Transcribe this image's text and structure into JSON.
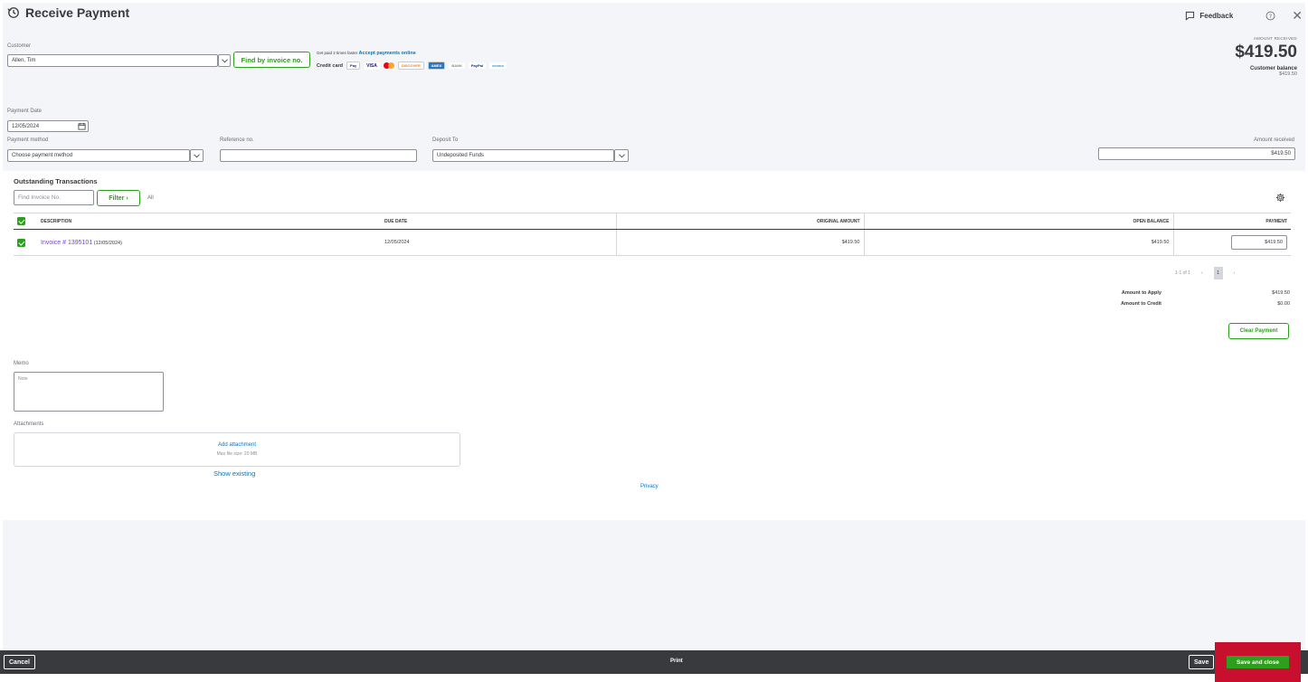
{
  "header": {
    "title": "Receive Payment",
    "feedback_label": "Feedback",
    "history_icon": "history-icon",
    "help_icon": "help-icon",
    "close_icon": "close-icon"
  },
  "customer": {
    "label": "Customer",
    "value": "Allen, Tim",
    "find_by_invoice_label": "Find by invoice no."
  },
  "promo": {
    "text": "Get paid 2 times faster",
    "link": "Accept payments online",
    "credit_card_label": "Credit card",
    "cards": [
      "Pay",
      "VISA",
      "DISCOVER",
      "AMEX",
      "BANK",
      "PayPal",
      "venmo"
    ]
  },
  "amount_summary": {
    "label": "AMOUNT RECEIVED",
    "value": "$419.50",
    "customer_balance_label": "Customer balance",
    "customer_balance_value": "$419.50"
  },
  "payment_date": {
    "label": "Payment Date",
    "value": "12/05/2024"
  },
  "payment_method": {
    "label": "Payment method",
    "placeholder": "Choose payment method"
  },
  "reference": {
    "label": "Reference no.",
    "value": ""
  },
  "deposit_to": {
    "label": "Deposit To",
    "value": "Undeposited Funds"
  },
  "amount_received": {
    "label": "Amount received",
    "value": "$419.50"
  },
  "outstanding": {
    "title": "Outstanding Transactions",
    "search_placeholder": "Find Invoice No.",
    "filter_label": "Filter",
    "all_label": "All",
    "columns": [
      "DESCRIPTION",
      "DUE DATE",
      "ORIGINAL AMOUNT",
      "OPEN BALANCE",
      "PAYMENT"
    ],
    "rows": [
      {
        "invoice": "Invoice # 1395101",
        "invoice_date": "(12/05/2024)",
        "due_date": "12/05/2024",
        "original_amount": "$419.50",
        "open_balance": "$419.50",
        "payment": "$419.50"
      }
    ],
    "pager_text": "1-1 of 1",
    "current_page": "1"
  },
  "totals": {
    "apply_label": "Amount to Apply",
    "apply_value": "$419.50",
    "credit_label": "Amount to Credit",
    "credit_value": "$0.00",
    "clear_payment_label": "Clear Payment"
  },
  "memo": {
    "label": "Memo",
    "placeholder": "Note"
  },
  "attachments": {
    "label": "Attachments",
    "add_label": "Add attachment",
    "max_size": "Max file size: 20 MB",
    "show_existing": "Show existing"
  },
  "privacy_label": "Privacy",
  "footer": {
    "cancel": "Cancel",
    "print": "Print",
    "save": "Save",
    "save_and_close": "Save and close"
  }
}
